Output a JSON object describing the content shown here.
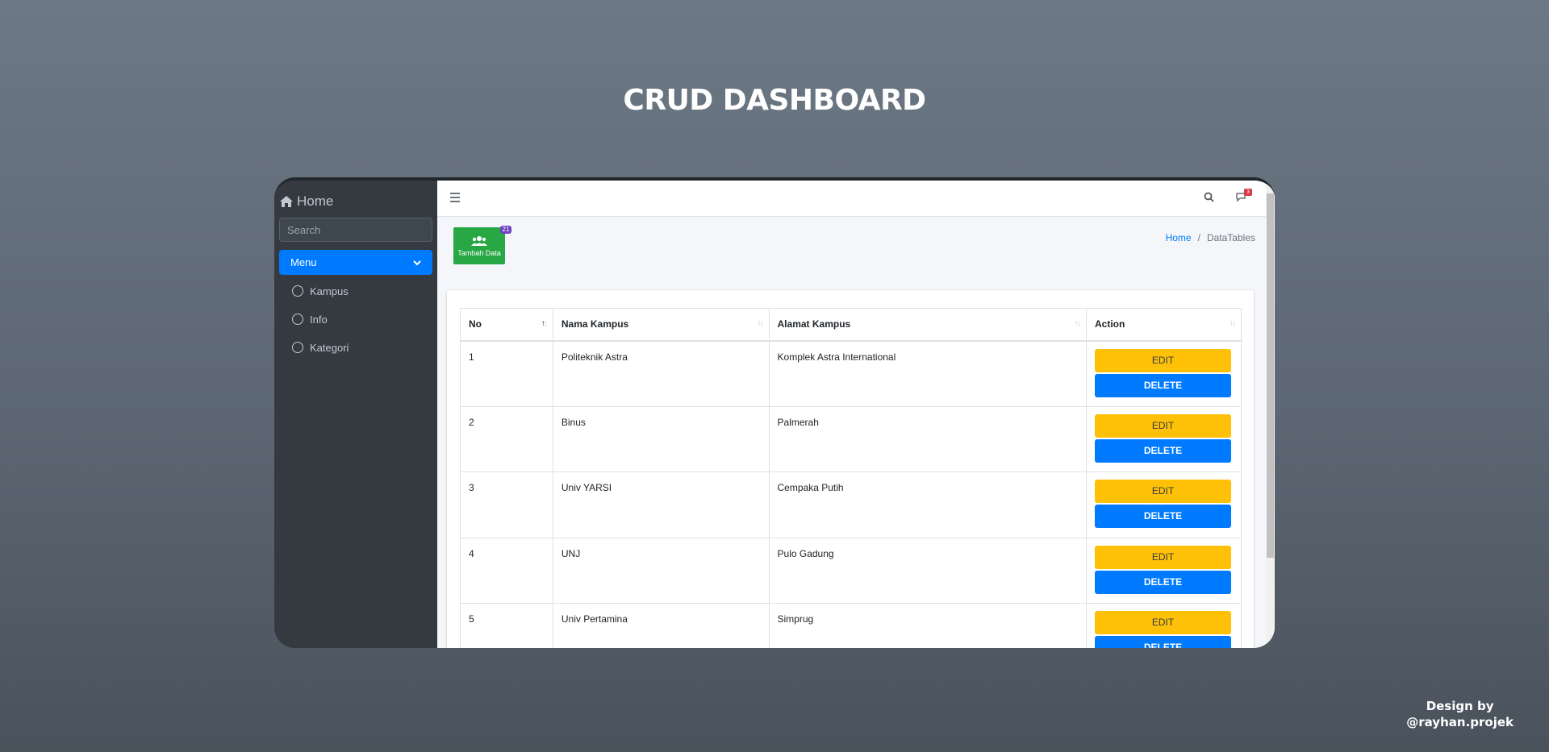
{
  "heading": "CRUD DASHBOARD",
  "credit": {
    "line1": "Design by",
    "line2": "@rayhan.projek"
  },
  "sidebar": {
    "brand": "Home",
    "search_placeholder": "Search",
    "menu_label": "Menu",
    "items": [
      {
        "label": "Kampus"
      },
      {
        "label": "Info"
      },
      {
        "label": "Kategori"
      }
    ]
  },
  "navbar": {
    "chat_badge": "3"
  },
  "toolbar": {
    "add_label": "Tambah Data",
    "add_badge": "21"
  },
  "breadcrumb": {
    "home": "Home",
    "separator": "/",
    "current": "DataTables"
  },
  "table": {
    "headers": [
      "No",
      "Nama Kampus",
      "Alamat Kampus",
      "Action"
    ],
    "rows": [
      {
        "no": "1",
        "nama": "Politeknik Astra",
        "alamat": "Komplek Astra International"
      },
      {
        "no": "2",
        "nama": "Binus",
        "alamat": "Palmerah"
      },
      {
        "no": "3",
        "nama": "Univ YARSI",
        "alamat": "Cempaka Putih"
      },
      {
        "no": "4",
        "nama": "UNJ",
        "alamat": "Pulo Gadung"
      },
      {
        "no": "5",
        "nama": "Univ Pertamina",
        "alamat": "Simprug"
      }
    ],
    "edit_label": "EDIT",
    "delete_label": "DELETE"
  },
  "colors": {
    "primary": "#007bff",
    "success": "#28a745",
    "warning": "#ffc107",
    "sidebar_bg": "#343a40",
    "badge_purple": "#6f42c1",
    "badge_red": "#dc3545"
  },
  "icons": [
    "home-icon",
    "search-icon",
    "chevron-down-icon",
    "circle-icon",
    "hamburger-icon",
    "chat-icon",
    "users-icon",
    "sort-icon"
  ]
}
